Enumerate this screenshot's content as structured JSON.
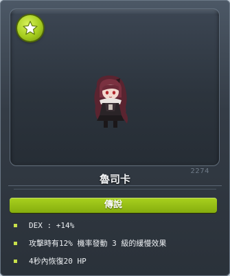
{
  "tooltip": {
    "pet_name": "魯司卡",
    "level_code": "2274",
    "rarity": "傳說",
    "effects": [
      "DEX : +14%",
      "攻擊時有12% 機率發動 3 級的緩慢效果",
      "4秒內恢復20 HP"
    ]
  },
  "colors": {
    "rarity_green": "#95bf15",
    "bullet_green": "#c8e14a",
    "panel_dark": "#2c343d"
  },
  "icons": {
    "badge": "star-icon",
    "bullet": "square-bullet-icon"
  }
}
